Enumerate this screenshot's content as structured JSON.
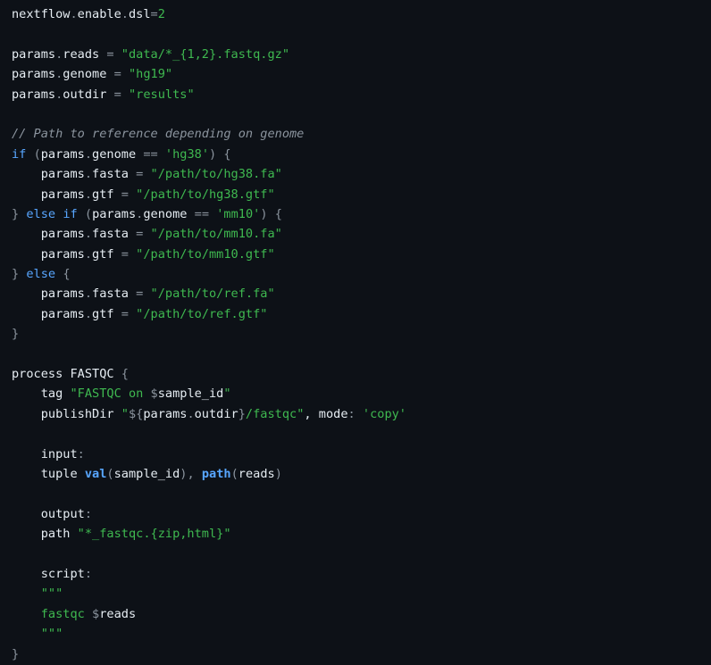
{
  "colors": {
    "background": "#0d1117",
    "text": "#e6edf3",
    "punctuation": "#8b949e",
    "string": "#3fb950",
    "keyword": "#58a6ff",
    "comment": "#8b949e"
  },
  "code": {
    "lines": [
      [
        [
          "nextflow",
          "plain"
        ],
        [
          ".",
          "op"
        ],
        [
          "enable",
          "plain"
        ],
        [
          ".",
          "op"
        ],
        [
          "dsl",
          "plain"
        ],
        [
          "=",
          "op"
        ],
        [
          "2",
          "num"
        ]
      ],
      [],
      [
        [
          "params",
          "plain"
        ],
        [
          ".",
          "op"
        ],
        [
          "reads ",
          "plain"
        ],
        [
          "=",
          "op"
        ],
        [
          " ",
          "plain"
        ],
        [
          "\"data/*_{1,2}.fastq.gz\"",
          "str"
        ]
      ],
      [
        [
          "params",
          "plain"
        ],
        [
          ".",
          "op"
        ],
        [
          "genome ",
          "plain"
        ],
        [
          "=",
          "op"
        ],
        [
          " ",
          "plain"
        ],
        [
          "\"hg19\"",
          "str"
        ]
      ],
      [
        [
          "params",
          "plain"
        ],
        [
          ".",
          "op"
        ],
        [
          "outdir ",
          "plain"
        ],
        [
          "=",
          "op"
        ],
        [
          " ",
          "plain"
        ],
        [
          "\"results\"",
          "str"
        ]
      ],
      [],
      [
        [
          "// Path to reference depending on genome",
          "comment"
        ]
      ],
      [
        [
          "if",
          "kw"
        ],
        [
          " ",
          "plain"
        ],
        [
          "(",
          "op"
        ],
        [
          "params",
          "plain"
        ],
        [
          ".",
          "op"
        ],
        [
          "genome ",
          "plain"
        ],
        [
          "==",
          "op"
        ],
        [
          " ",
          "plain"
        ],
        [
          "'hg38'",
          "str"
        ],
        [
          ")",
          "op"
        ],
        [
          " ",
          "plain"
        ],
        [
          "{",
          "op"
        ]
      ],
      [
        [
          "    params",
          "plain"
        ],
        [
          ".",
          "op"
        ],
        [
          "fasta ",
          "plain"
        ],
        [
          "=",
          "op"
        ],
        [
          " ",
          "plain"
        ],
        [
          "\"/path/to/hg38.fa\"",
          "str"
        ]
      ],
      [
        [
          "    params",
          "plain"
        ],
        [
          ".",
          "op"
        ],
        [
          "gtf ",
          "plain"
        ],
        [
          "=",
          "op"
        ],
        [
          " ",
          "plain"
        ],
        [
          "\"/path/to/hg38.gtf\"",
          "str"
        ]
      ],
      [
        [
          "}",
          "op"
        ],
        [
          " ",
          "plain"
        ],
        [
          "else",
          "kw"
        ],
        [
          " ",
          "plain"
        ],
        [
          "if",
          "kw"
        ],
        [
          " ",
          "plain"
        ],
        [
          "(",
          "op"
        ],
        [
          "params",
          "plain"
        ],
        [
          ".",
          "op"
        ],
        [
          "genome ",
          "plain"
        ],
        [
          "==",
          "op"
        ],
        [
          " ",
          "plain"
        ],
        [
          "'mm10'",
          "str"
        ],
        [
          ")",
          "op"
        ],
        [
          " ",
          "plain"
        ],
        [
          "{",
          "op"
        ]
      ],
      [
        [
          "    params",
          "plain"
        ],
        [
          ".",
          "op"
        ],
        [
          "fasta ",
          "plain"
        ],
        [
          "=",
          "op"
        ],
        [
          " ",
          "plain"
        ],
        [
          "\"/path/to/mm10.fa\"",
          "str"
        ]
      ],
      [
        [
          "    params",
          "plain"
        ],
        [
          ".",
          "op"
        ],
        [
          "gtf ",
          "plain"
        ],
        [
          "=",
          "op"
        ],
        [
          " ",
          "plain"
        ],
        [
          "\"/path/to/mm10.gtf\"",
          "str"
        ]
      ],
      [
        [
          "}",
          "op"
        ],
        [
          " ",
          "plain"
        ],
        [
          "else",
          "kw"
        ],
        [
          " ",
          "plain"
        ],
        [
          "{",
          "op"
        ]
      ],
      [
        [
          "    params",
          "plain"
        ],
        [
          ".",
          "op"
        ],
        [
          "fasta ",
          "plain"
        ],
        [
          "=",
          "op"
        ],
        [
          " ",
          "plain"
        ],
        [
          "\"/path/to/ref.fa\"",
          "str"
        ]
      ],
      [
        [
          "    params",
          "plain"
        ],
        [
          ".",
          "op"
        ],
        [
          "gtf ",
          "plain"
        ],
        [
          "=",
          "op"
        ],
        [
          " ",
          "plain"
        ],
        [
          "\"/path/to/ref.gtf\"",
          "str"
        ]
      ],
      [
        [
          "}",
          "op"
        ]
      ],
      [],
      [
        [
          "process FASTQC ",
          "plain"
        ],
        [
          "{",
          "op"
        ]
      ],
      [
        [
          "    tag ",
          "plain"
        ],
        [
          "\"FASTQC on ",
          "str"
        ],
        [
          "$",
          "op"
        ],
        [
          "sample_id",
          "plain"
        ],
        [
          "\"",
          "str"
        ]
      ],
      [
        [
          "    publishDir ",
          "plain"
        ],
        [
          "\"",
          "str"
        ],
        [
          "${",
          "op"
        ],
        [
          "params",
          "plain"
        ],
        [
          ".",
          "op"
        ],
        [
          "outdir",
          "plain"
        ],
        [
          "}",
          "op"
        ],
        [
          "/fastqc\"",
          "str"
        ],
        [
          ", mode",
          "plain"
        ],
        [
          ":",
          "op"
        ],
        [
          " ",
          "plain"
        ],
        [
          "'copy'",
          "str"
        ]
      ],
      [],
      [
        [
          "    input",
          "plain"
        ],
        [
          ":",
          "op"
        ]
      ],
      [
        [
          "    tuple ",
          "plain"
        ],
        [
          "val",
          "fn"
        ],
        [
          "(",
          "op"
        ],
        [
          "sample_id",
          "plain"
        ],
        [
          "),",
          "op"
        ],
        [
          " ",
          "plain"
        ],
        [
          "path",
          "fn"
        ],
        [
          "(",
          "op"
        ],
        [
          "reads",
          "plain"
        ],
        [
          ")",
          "op"
        ]
      ],
      [],
      [
        [
          "    output",
          "plain"
        ],
        [
          ":",
          "op"
        ]
      ],
      [
        [
          "    path ",
          "plain"
        ],
        [
          "\"*_fastqc.{zip,html}\"",
          "str"
        ]
      ],
      [],
      [
        [
          "    script",
          "plain"
        ],
        [
          ":",
          "op"
        ]
      ],
      [
        [
          "    ",
          "plain"
        ],
        [
          "\"\"\"",
          "str"
        ]
      ],
      [
        [
          "    ",
          "plain"
        ],
        [
          "fastqc ",
          "str"
        ],
        [
          "$",
          "op"
        ],
        [
          "reads",
          "plain"
        ]
      ],
      [
        [
          "    ",
          "plain"
        ],
        [
          "\"\"\"",
          "str"
        ]
      ],
      [
        [
          "}",
          "op"
        ]
      ]
    ]
  }
}
